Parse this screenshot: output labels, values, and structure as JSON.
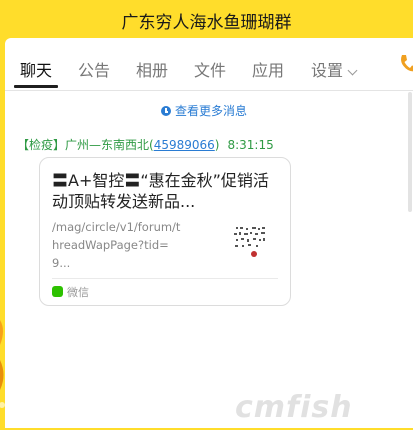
{
  "window": {
    "title": "广东穷人海水鱼珊瑚群"
  },
  "tabs": [
    {
      "label": "聊天",
      "active": true
    },
    {
      "label": "公告"
    },
    {
      "label": "相册"
    },
    {
      "label": "文件"
    },
    {
      "label": "应用"
    },
    {
      "label": "设置"
    }
  ],
  "colors": {
    "accent": "#ffdd2b",
    "link": "#2a7cd3",
    "sender": "#2f9a44"
  },
  "chat": {
    "more_messages": "查看更多消息",
    "message": {
      "sender_tag": "【检疫】广州—东南西北(",
      "sender_qq": "45989066",
      "sender_close": ")",
      "time": "8:31:15",
      "card": {
        "title": "〓A+智控〓“惠在金秋”促销活动顶贴转发送新品...",
        "url": "/mag/circle/v1/forum/threadWapPage?tid=9...",
        "source": "微信",
        "thumb_icon": "qr-code-thumbnail"
      }
    }
  },
  "watermark": "cmfish"
}
